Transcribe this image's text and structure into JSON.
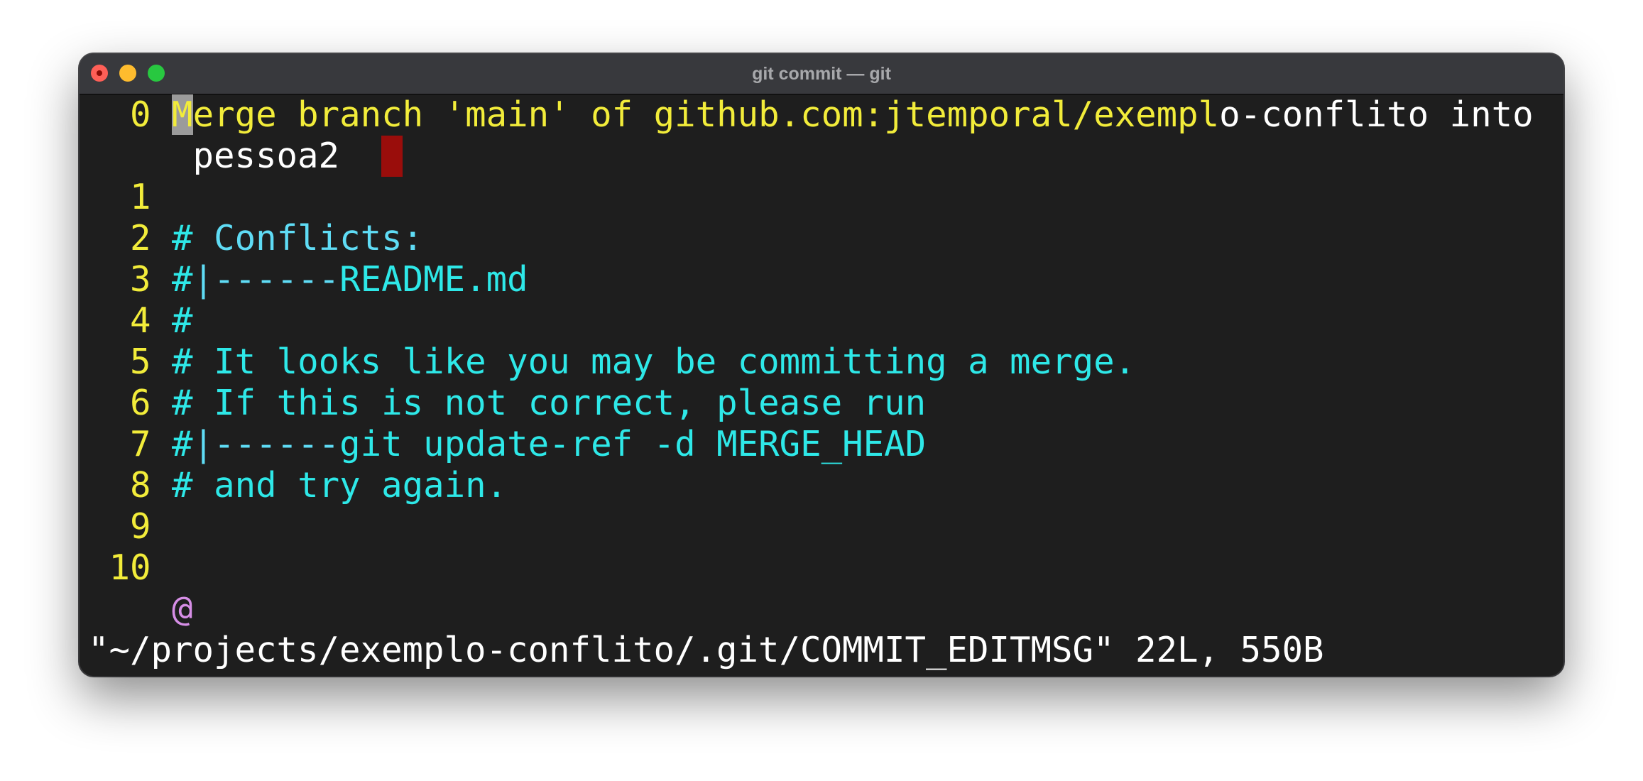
{
  "window": {
    "title": "git commit — git",
    "buttons": [
      "close",
      "minimize",
      "zoom"
    ]
  },
  "editor": {
    "lines": [
      {
        "number": "0",
        "cursor_char": "M",
        "summary_in_limit": "erge branch 'main' of github.com:jtemporal/exempl",
        "summary_overflow": "o-conflito into",
        "wrap": "pessoa2"
      },
      {
        "number": "1",
        "text": ""
      },
      {
        "number": "2",
        "hash": "#",
        "text": " Conflicts:"
      },
      {
        "number": "3",
        "hash": "#",
        "tab_marker": "|------",
        "text": "README.md"
      },
      {
        "number": "4",
        "hash": "#",
        "text": ""
      },
      {
        "number": "5",
        "hash": "#",
        "text": " It looks like you may be committing a merge."
      },
      {
        "number": "6",
        "hash": "#",
        "text": " If this is not correct, please run"
      },
      {
        "number": "7",
        "hash": "#",
        "tab_marker": "|------",
        "text": "git update-ref -d MERGE_HEAD"
      },
      {
        "number": "8",
        "hash": "#",
        "text": " and try again."
      },
      {
        "number": "9",
        "text": ""
      },
      {
        "number": "10",
        "text": ""
      }
    ],
    "more_lines_marker": "@",
    "status_line": "\"~/projects/exemplo-conflito/.git/COMMIT_EDITMSG\" 22L, 550B"
  },
  "colors": {
    "background": "#1e1e1e",
    "line_number": "#f2ec3a",
    "summary": "#f2ec3a",
    "comment": "#2ee8e8",
    "comment_keyword": "#5fdcf5",
    "overflow": "#ffffff",
    "error_block": "#9a0d0b",
    "more_marker": "#d68ee6"
  }
}
